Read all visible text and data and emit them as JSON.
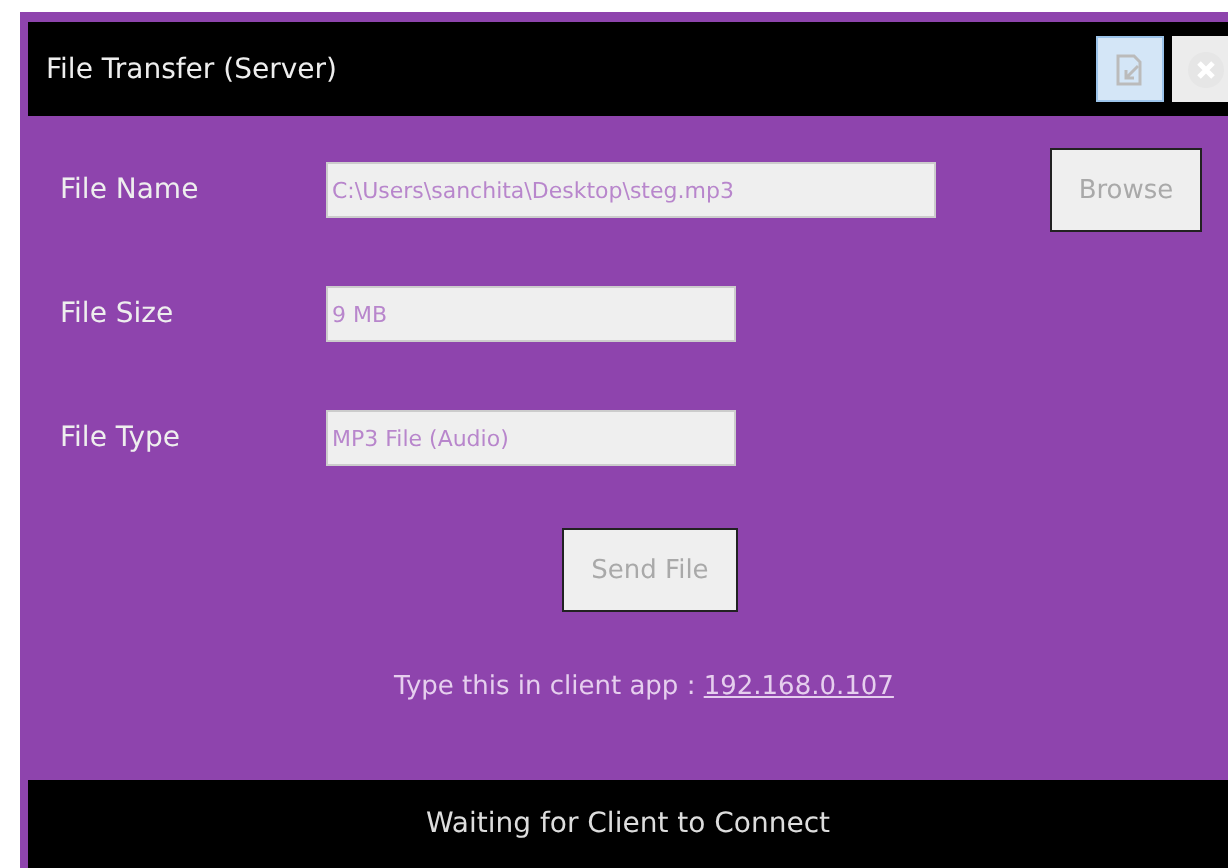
{
  "window": {
    "title": "File Transfer (Server)"
  },
  "title_buttons": [
    {
      "kind": "restore",
      "selected": true
    },
    {
      "kind": "close",
      "selected": false
    }
  ],
  "fields": [
    {
      "label": "File Name",
      "value": "C:\\Users\\sanchita\\Desktop\\steg.mp3",
      "wide": true
    },
    {
      "label": "File Size",
      "value": "9 MB",
      "wide": false
    },
    {
      "label": "File Type",
      "value": "MP3 File (Audio)",
      "wide": false
    }
  ],
  "browse_button": {
    "label": "Browse",
    "disabled": true
  },
  "send_button": {
    "label": "Send File",
    "disabled": true
  },
  "client_hint": {
    "text": "Type this in client app :",
    "address": "192.168.0.107"
  },
  "status_bar": "Waiting for Client to Connect"
}
